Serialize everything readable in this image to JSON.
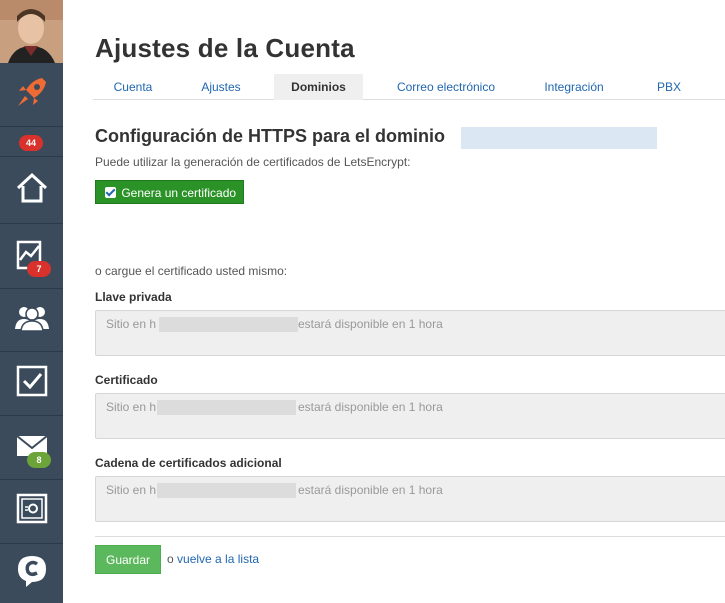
{
  "page": {
    "title": "Ajustes de la Cuenta"
  },
  "tabs": [
    {
      "label": "Cuenta"
    },
    {
      "label": "Ajustes"
    },
    {
      "label": "Dominios",
      "active": true
    },
    {
      "label": "Correo electrónico"
    },
    {
      "label": "Integración"
    },
    {
      "label": "PBX"
    }
  ],
  "sidebar": {
    "badges": {
      "rocket": "44",
      "activity": "7",
      "mail": "8"
    },
    "icons": [
      "avatar",
      "rocket-icon",
      "home-icon",
      "chart-icon",
      "people-icon",
      "checkbox-icon",
      "mail-icon",
      "safe-icon",
      "chat-c-icon"
    ]
  },
  "https": {
    "title": "Configuración de HTTPS para el dominio",
    "hint": "Puede utilizar la generación de certificados de LetsEncrypt:",
    "generate_label": "Genera un certificado",
    "or_upload": "o cargue el certificado usted mismo:"
  },
  "fields": [
    {
      "label": "Llave privada",
      "prefix": "Sitio en h",
      "suffix": "estará disponible en 1 hora"
    },
    {
      "label": "Certificado",
      "prefix": "Sitio en h",
      "suffix": "estará disponible en 1 hora"
    },
    {
      "label": "Cadena de certificados adicional",
      "prefix": "Sitio en h",
      "suffix": "estará disponible en 1 hora"
    }
  ],
  "actions": {
    "save": "Guardar",
    "or": "o",
    "back": "vuelve a la lista"
  },
  "colors": {
    "sidebar": "#3b4b5c",
    "accent": "#2067b0",
    "generate_button": "#2b9227",
    "save_button": "#5cb85c",
    "badge_red": "#d9312b",
    "badge_green": "#6ca43a"
  }
}
